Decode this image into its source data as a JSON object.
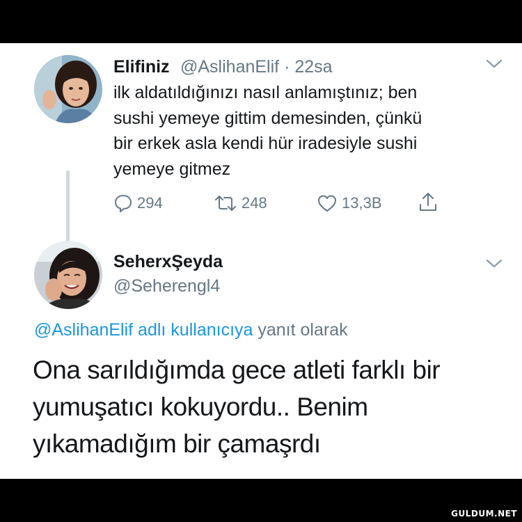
{
  "tweet": {
    "display_name": "Elifiniz",
    "handle": "@AslihanElif",
    "separator": "·",
    "time": "22sa",
    "text_lines": [
      "ilk aldatıldığınızı nasıl anlamıştınız; ben",
      "sushi yemeye gittim demesinden, çünkü",
      "bir erkek asla kendi hür iradesiyle sushi",
      "yemeye gitmez"
    ],
    "actions": {
      "reply_icon": "reply-icon",
      "reply_count": "294",
      "retweet_icon": "retweet-icon",
      "retweet_count": "248",
      "like_icon": "heart-icon",
      "like_count": "13,3B",
      "share_icon": "share-icon"
    }
  },
  "reply": {
    "display_name": "SeherxŞeyda",
    "handle": "@Seherengl4",
    "context_mention": "@AslihanElif adlı kullanıcıya",
    "context_suffix": "yanıt olarak",
    "text_lines": [
      "Ona sarıldığımda gece atleti farklı bir",
      "yumuşatıcı kokuyordu.. Benim",
      "yıkamadığım bir çamaşrdı"
    ]
  },
  "watermark": "GULDUM.NET",
  "colors": {
    "text": "#14171a",
    "secondary": "#657786",
    "link": "#1b95e0",
    "thread_line": "#cfd9de",
    "background_frame": "#000000"
  }
}
